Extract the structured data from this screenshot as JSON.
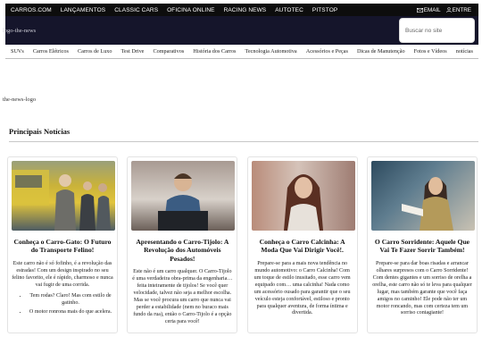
{
  "topbar": {
    "links": [
      "CARROS.COM",
      "LANÇAMENTOS",
      "CLASSIC CARS",
      "OFICINA ONLINE",
      "RACING NEWS",
      "AUTOTEC",
      "PITSTOP"
    ],
    "auth": {
      "email_label": "EMAIL",
      "login_label": "ENTRE"
    }
  },
  "header": {
    "logo_alt": "logo-the-news",
    "search_placeholder": "Buscar no site"
  },
  "categories": [
    "SUVs",
    "Carros Elétricos",
    "Carros de Luxo",
    "Test Drive",
    "Comparativos",
    "História dos Carros",
    "Tecnologia Automotiva",
    "Acessórios e Peças",
    "Dicas de Manutenção",
    "Fotos e Vídeos",
    "notícias"
  ],
  "banner": {
    "logo_alt": "the-news-logo"
  },
  "section": {
    "title": "Principais Notícias"
  },
  "cards": [
    {
      "title": "Conheça o Carro-Gato: O Futuro do Transporte Felino!",
      "text": "Este carro não é só fofinho, é a revolução das estradas! Com um design inspirado no seu felino favorito, ele é rápido, charmoso e nunca vai fugir de uma corrida.",
      "bullets": [
        "Tem rodas? Claro! Mas com estilo de gatinho.",
        "O motor ronrona mais do que acelera."
      ]
    },
    {
      "title": "Apresentando o Carro-Tijolo: A Revolução dos Automóveis Pesados!",
      "text": "Este não é um carro qualquer. O Carro-Tijolo é uma verdadeira obra-prima da engenharia… feita inteiramente de tijolos! Se você quer velocidade, talvez não seja a melhor escolha. Mas se você procura um carro que nunca vai perder a estabilidade (nem no buraco mais fundo da rua), então o Carro-Tijolo é a opção certa para você!",
      "bullets": []
    },
    {
      "title": "Conheça o Carro Calcinha: A Moda Que Vai Dirigir Você!.",
      "text": "Prepare-se para a mais nova tendência no mundo automotivo: o Carro Calcinha! Com um toque de estilo inusitado, esse carro vem equipado com… uma calcinha! Nada como um acessório ousado para garantir que o seu veículo esteja confortável, estiloso e pronto para qualquer aventura, de forma íntima e divertida.",
      "bullets": []
    },
    {
      "title": "O Carro Sorridente: Aquele Que Vai Te Fazer Sorrir Também!",
      "text": "Prepare-se para dar boas risadas e arrancar olhares surpresos com o Carro Sorridente! Com dentes gigantes e um sorriso de orelha a orelha, este carro não só te leva para qualquer lugar, mas também garante que você faça amigos no caminho! Ele pode não ter um motor roncando, mas com certeza tem um sorriso contagiante!",
      "bullets": []
    }
  ]
}
